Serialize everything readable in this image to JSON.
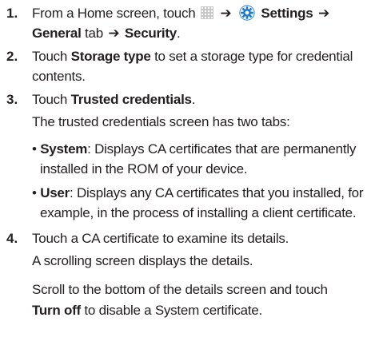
{
  "steps": [
    {
      "number": "1.",
      "line1_prefix": "From a Home screen, touch",
      "arrow": "➔",
      "settings_label": "Settings",
      "general_tab": "General",
      "tab_word": "tab",
      "security": "Security",
      "period": "."
    },
    {
      "number": "2.",
      "touch": "Touch",
      "storage_type": "Storage type",
      "line1_suffix": "to set a storage type for credential",
      "line2": "contents."
    },
    {
      "number": "3.",
      "touch": "Touch",
      "trusted_credentials": "Trusted credentials",
      "period": ".",
      "desc": "The trusted credentials screen has two tabs:",
      "bullets": [
        {
          "term": "System",
          "line1": ": Displays CA certificates that are permanently",
          "line2": "installed in the ROM of your device."
        },
        {
          "term": "User",
          "line1": ": Displays any CA certificates that you installed, for",
          "line2": "example, in the process of installing a client certificate."
        }
      ]
    },
    {
      "number": "4.",
      "line1": "Touch a CA certificate to examine its details.",
      "line2": "A scrolling screen displays the details.",
      "line3": "Scroll to the bottom of the details screen and touch",
      "turn_off": "Turn off",
      "line4_suffix": "to disable a System certificate."
    }
  ],
  "colors": {
    "text": "#231f20",
    "settings_icon_blue": "#1f78c8",
    "apps_icon_gray": "#b9b9b9"
  },
  "icons": {
    "apps": "apps-grid-icon",
    "settings": "settings-gear-icon"
  }
}
